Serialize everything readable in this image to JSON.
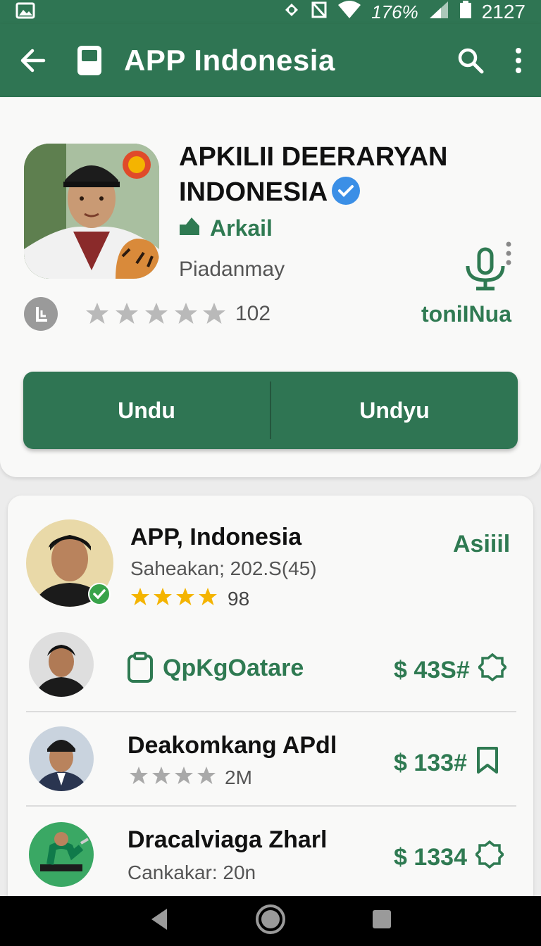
{
  "status": {
    "battery_pct": "176%",
    "time": "2127"
  },
  "app_bar": {
    "title": "APP Indonesia"
  },
  "app": {
    "name": "APKILII DEERARYAN INDONESIA",
    "developer": "Arkail",
    "category": "Piadanmay",
    "rating_count": "102",
    "side_label": "toniINua",
    "button_left": "Undu",
    "button_right": "Undyu"
  },
  "list": [
    {
      "title": "APP, Indonesia",
      "subtitle": "Saheakan; 202.S(45)",
      "rating_value": "98",
      "right": "Asiiil"
    },
    {
      "title": "QpKgOatare",
      "right": "$ 43S#"
    },
    {
      "title": "Deakomkang APdl",
      "rating_value": "2M",
      "right": "$ 133#"
    },
    {
      "title": "Dracalviaga Zharl",
      "subtitle": "Cankakar: 20n",
      "right": "$ 1334"
    }
  ],
  "colors": {
    "brand_green": "#2f7553",
    "accent_green": "#2f7a52",
    "verified_blue": "#3b8fe6",
    "star_gold": "#f4b400"
  }
}
